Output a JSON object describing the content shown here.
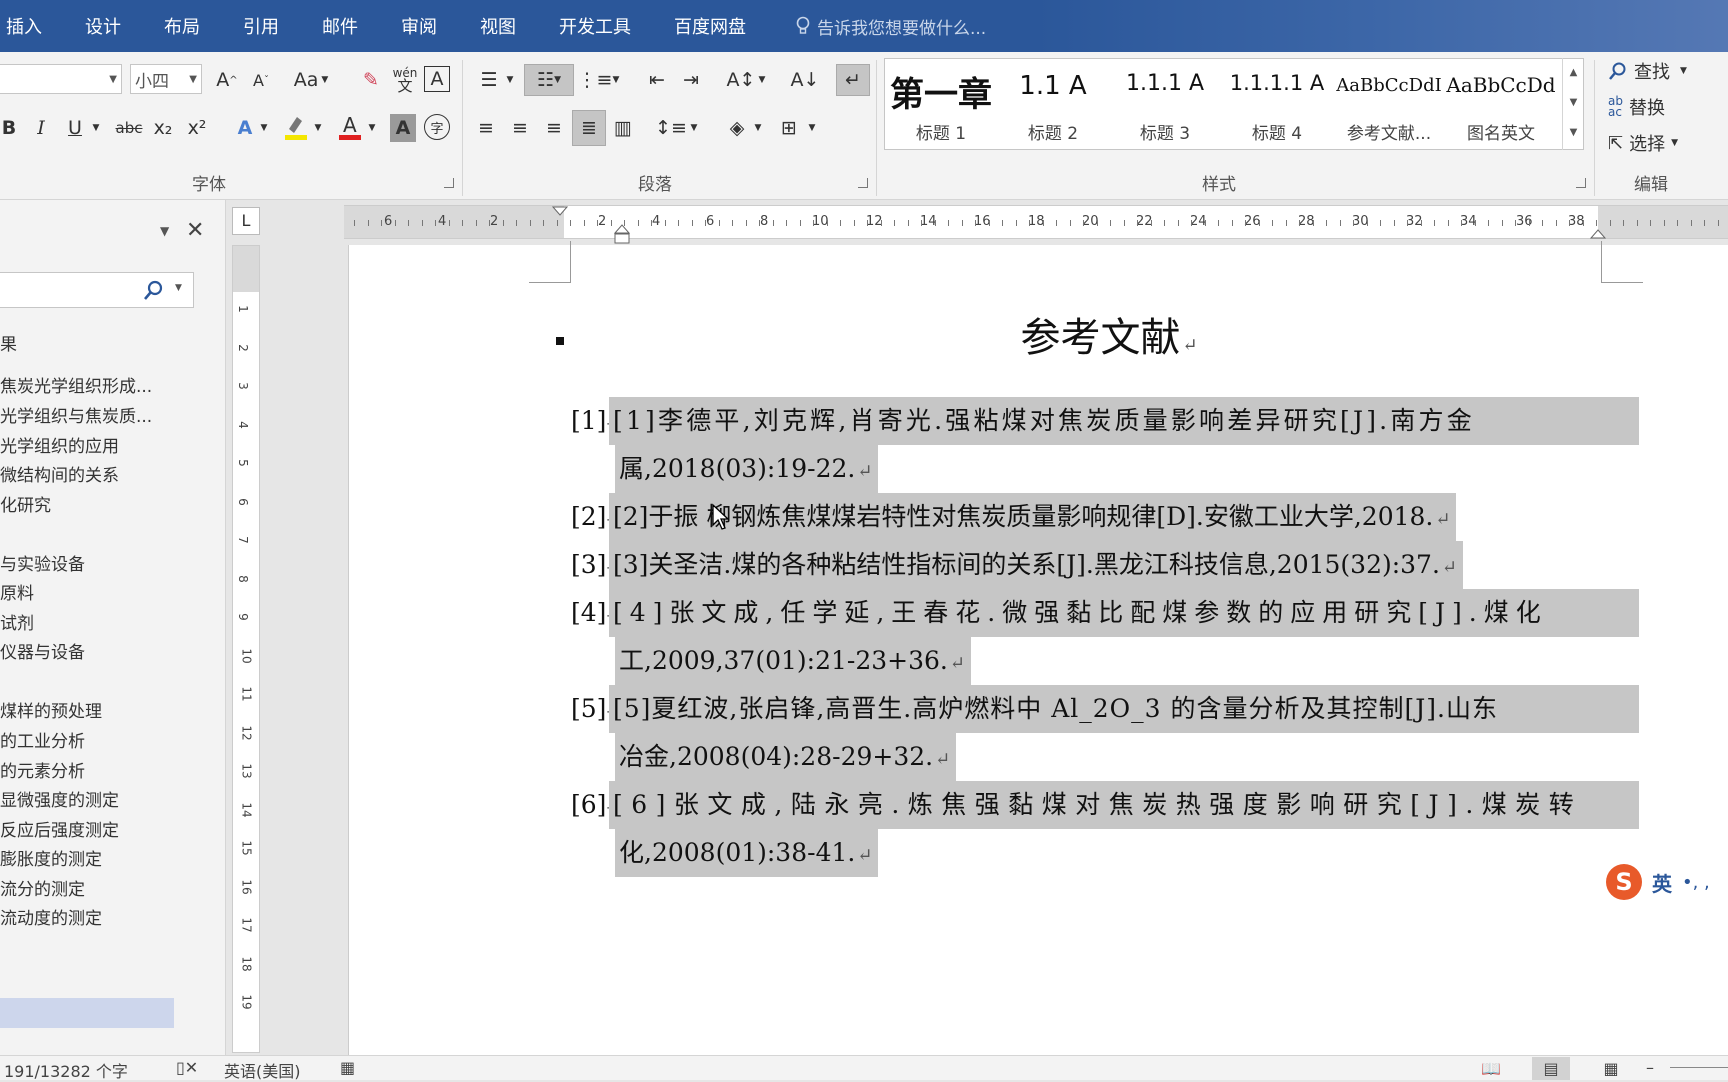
{
  "ribbon_tabs": [
    "插入",
    "设计",
    "布局",
    "引用",
    "邮件",
    "审阅",
    "视图",
    "开发工具",
    "百度网盘"
  ],
  "tell_me_placeholder": "告诉我您想要做什么...",
  "font_group": {
    "label": "字体",
    "font_name": "",
    "font_size": "小四",
    "case_button": "Aa",
    "bold": "B",
    "italic": "I",
    "underline": "U",
    "strikethrough": "abc",
    "subscript": "x₂",
    "superscript": "x²",
    "grow": "A",
    "shrink": "A",
    "phonetic": "wén",
    "phonetic_char": "文",
    "border_char": "A",
    "enclose_char": "字"
  },
  "paragraph_group": {
    "label": "段落"
  },
  "styles_group": {
    "label": "样式",
    "items": [
      {
        "sample": "第一章",
        "label": "标题 1"
      },
      {
        "sample": "1.1  A",
        "label": "标题 2"
      },
      {
        "sample": "1.1.1  A",
        "label": "标题 3"
      },
      {
        "sample": "1.1.1.1  A",
        "label": "标题 4"
      },
      {
        "sample": "AaBbCcDdI",
        "label": "参考文献..."
      },
      {
        "sample": "AaBbCcDd",
        "label": "图名英文"
      }
    ]
  },
  "editing_group": {
    "label": "编辑",
    "find": "查找",
    "replace": "替换",
    "select": "选择"
  },
  "nav_pane": {
    "items": [
      "果",
      "焦炭光学组织形成...",
      "光学组织与焦炭质...",
      "光学组织的应用",
      "微结构间的关系",
      "化研究",
      "与实验设备",
      "原料",
      "试剂",
      "仪器与设备",
      "煤样的预处理",
      "的工业分析",
      "的元素分析",
      "显微强度的测定",
      "反应后强度测定",
      "膨胀度的测定",
      "流分的测定",
      "流动度的测定"
    ]
  },
  "ruler": {
    "corner": "L",
    "h_labels": [
      "6",
      "4",
      "2",
      "2",
      "4",
      "6",
      "8",
      "10",
      "12",
      "14",
      "16",
      "18",
      "20",
      "22",
      "24",
      "26",
      "28",
      "30",
      "32",
      "34",
      "36",
      "38"
    ],
    "v_labels": [
      "1",
      "2",
      "3",
      "4",
      "5",
      "6",
      "7",
      "8",
      "9",
      "10",
      "11",
      "12",
      "13",
      "14",
      "15",
      "16",
      "17",
      "18",
      "19"
    ]
  },
  "document": {
    "title": "参考文献",
    "references": [
      {
        "num": "[1]",
        "lines": [
          "[1]李德平,刘克辉,肖寄光.强粘煤对焦炭质量影响差异研究[J].南方金",
          "属,2018(03):19-22."
        ]
      },
      {
        "num": "[2]",
        "lines": [
          "[2]于振 柳钢炼焦煤煤岩特性对焦炭质量影响规律[D].安徽工业大学,2018."
        ]
      },
      {
        "num": "[3]",
        "lines": [
          "[3]关圣洁.煤的各种粘结性指标间的关系[J].黑龙江科技信息,2015(32):37."
        ]
      },
      {
        "num": "[4]",
        "lines": [
          "[4]张文成,任学延,王春花.微强黏比配煤参数的应用研究[J].煤化",
          "工,2009,37(01):21-23+36."
        ]
      },
      {
        "num": "[5]",
        "lines": [
          "[5]夏红波,张启锋,高晋生.高炉燃料中 Al_2O_3 的含量分析及其控制[J].山东",
          "冶金,2008(04):28-29+32."
        ]
      },
      {
        "num": "[6]",
        "lines": [
          "[6]张文成,陆永亮.炼焦强黏煤对焦炭热强度影响研究[J].煤炭转",
          "化,2008(01):38-41."
        ]
      }
    ]
  },
  "ime": {
    "logo": "S",
    "lang": "英",
    "punc": "•, ,"
  },
  "status_bar": {
    "word_count": "191/13282 个字",
    "language": "英语(美国)"
  },
  "colors": {
    "ribbon_blue": "#2b579a",
    "selection_grey": "#c6c6c6",
    "nav_selected": "#cdd6ec"
  }
}
